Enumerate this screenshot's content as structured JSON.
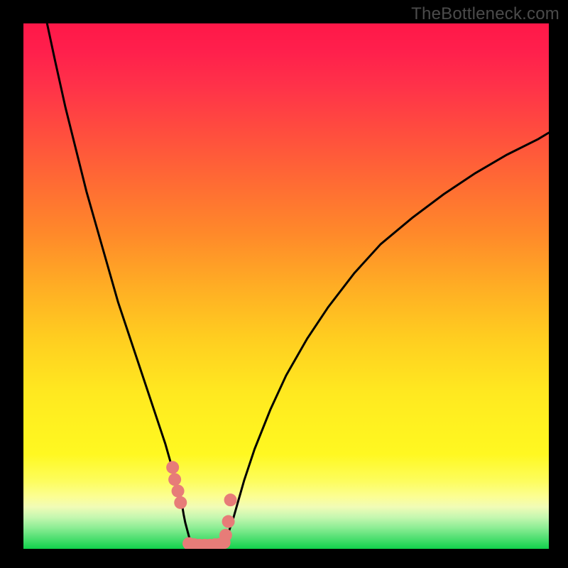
{
  "watermark": "TheBottleneck.com",
  "colors": {
    "frame": "#000000",
    "curve": "#000000",
    "marker": "#e77c78"
  },
  "chart_data": {
    "type": "line",
    "title": "",
    "xlabel": "",
    "ylabel": "",
    "xlim": [
      0,
      100
    ],
    "ylim": [
      0,
      100
    ],
    "grid": false,
    "legend": false,
    "series": [
      {
        "name": "left-branch",
        "x": [
          4.5,
          6,
          8,
          10,
          12,
          14,
          16,
          18,
          20,
          22,
          24,
          26,
          27,
          28,
          29,
          30,
          30.5,
          30.8,
          31.2,
          31.9
        ],
        "y": [
          100,
          93,
          84,
          76,
          68,
          61,
          54,
          47,
          41,
          35,
          29,
          23,
          20,
          16.5,
          13,
          9.5,
          6.5,
          5,
          3.5,
          0.9
        ]
      },
      {
        "name": "right-branch",
        "x": [
          38.5,
          39,
          40,
          41,
          42,
          44,
          47,
          50,
          54,
          58,
          63,
          68,
          74,
          80,
          86,
          92,
          98,
          100
        ],
        "y": [
          1.0,
          3,
          6,
          9.5,
          13,
          19,
          26.5,
          33,
          40,
          46,
          52.5,
          58,
          63,
          67.5,
          71.5,
          75,
          78,
          79.2
        ]
      },
      {
        "name": "valley-floor",
        "x": [
          31.5,
          32,
          33,
          34,
          35,
          36,
          37,
          38,
          38.5
        ],
        "y": [
          0.8,
          0.6,
          0.5,
          0.5,
          0.5,
          0.55,
          0.6,
          0.7,
          0.95
        ]
      }
    ],
    "markers": {
      "name": "highlighted-points",
      "x": [
        28.4,
        28.8,
        29.4,
        29.9,
        31.5,
        32.5,
        33.5,
        34.5,
        35.5,
        36.5,
        37.5,
        38.2,
        38.5,
        39.0,
        39.4
      ],
      "y": [
        15.5,
        13.2,
        11.0,
        8.8,
        1.0,
        0.8,
        0.7,
        0.7,
        0.7,
        0.8,
        0.9,
        1.2,
        2.6,
        5.2,
        9.3
      ]
    },
    "gradient_stops": [
      {
        "offset": 0.0,
        "color": "#ff1848"
      },
      {
        "offset": 0.2,
        "color": "#ff4b3f"
      },
      {
        "offset": 0.4,
        "color": "#ff892a"
      },
      {
        "offset": 0.6,
        "color": "#ffce20"
      },
      {
        "offset": 0.8,
        "color": "#fff520"
      },
      {
        "offset": 0.92,
        "color": "#f1fcb6"
      },
      {
        "offset": 1.0,
        "color": "#11d14b"
      }
    ]
  }
}
